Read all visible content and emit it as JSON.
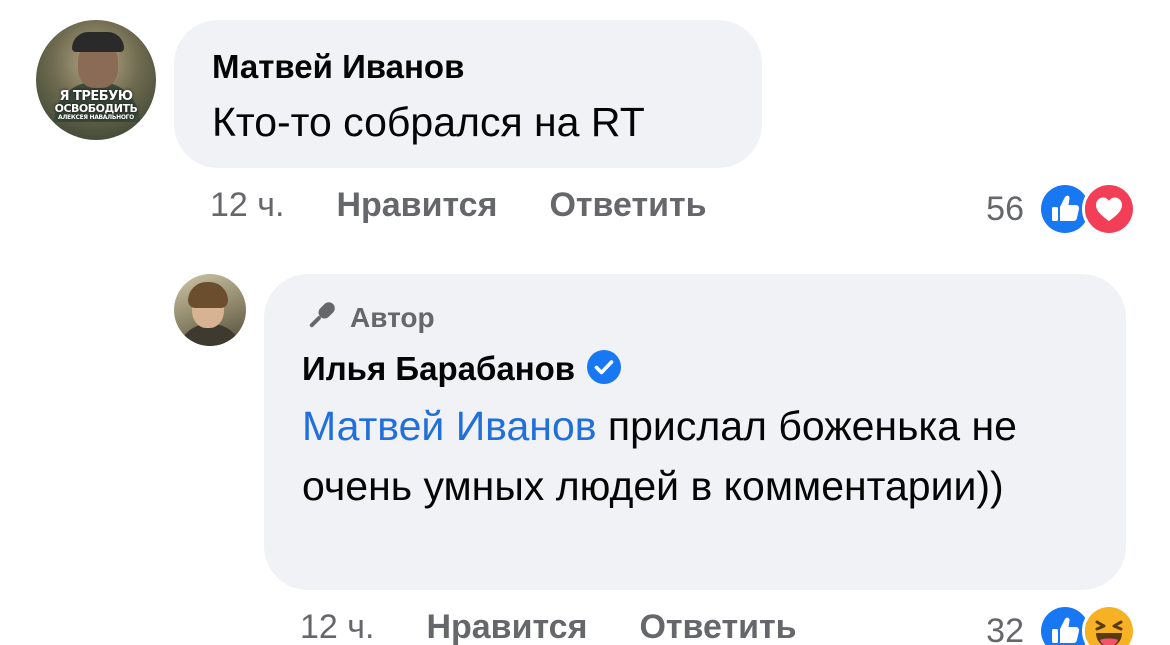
{
  "comments": [
    {
      "avatar_caption": [
        "Я ТРЕБУЮ",
        "ОСВОБОДИТЬ",
        "АЛЕКСЕЯ НАВАЛЬНОГО"
      ],
      "author": "Матвей Иванов",
      "text": "Кто-то собрался на RT",
      "time": "12 ч.",
      "like_label": "Нравится",
      "reply_label": "Ответить",
      "reaction_count": "56",
      "reactions": [
        "like-icon",
        "love-icon"
      ]
    },
    {
      "badge": "Автор",
      "author": "Илья Барабанов",
      "verified": true,
      "mention": "Матвей Иванов",
      "text": " прислал боженька не очень умных людей в комментарии))",
      "time": "12 ч.",
      "like_label": "Нравится",
      "reply_label": "Ответить",
      "reaction_count": "32",
      "reactions": [
        "like-icon",
        "haha-icon"
      ]
    }
  ],
  "colors": {
    "bubble": "#f0f2f5",
    "mention": "#216fdb",
    "secondary_text": "#65676b",
    "like_blue": "#1877f2",
    "love_red": "#f33e58",
    "haha_yellow": "#f7b125"
  }
}
